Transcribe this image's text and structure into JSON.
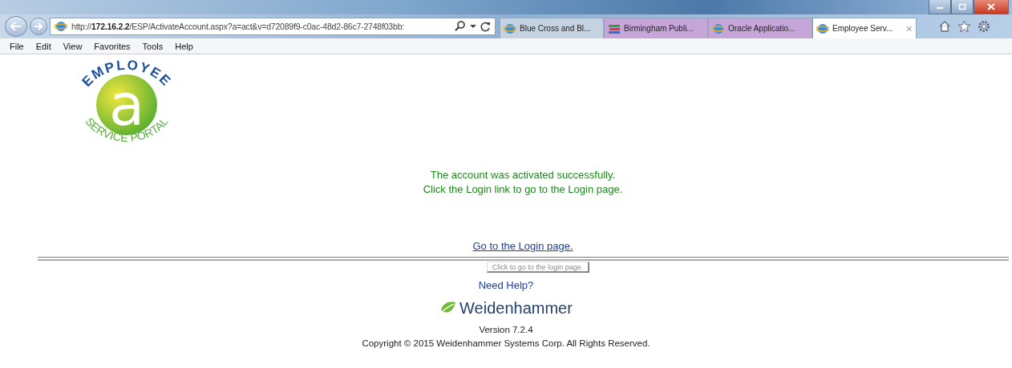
{
  "browser": {
    "address": {
      "prefix": "http://",
      "host": "172.16.2.2",
      "path": "/ESP/ActivateAccount.aspx?a=act&v=d72089f9-c0ac-48d2-86c7-2748f03bb:"
    },
    "tabs": [
      {
        "label": "Blue Cross and Bl...",
        "selected": false,
        "kind": "ie"
      },
      {
        "label": "Birmingham Publi...",
        "selected": false,
        "kind": "books"
      },
      {
        "label": "Oracle Applicatio...",
        "selected": false,
        "kind": "ie"
      },
      {
        "label": "Employee Serv...",
        "selected": true,
        "kind": "ie",
        "close": "×"
      }
    ],
    "menu": [
      "File",
      "Edit",
      "View",
      "Favorites",
      "Tools",
      "Help"
    ]
  },
  "logo": {
    "top": "EMPLOYEE",
    "letter": "a",
    "bottom": "SERVICE PORTAL"
  },
  "messages": [
    "The account was activated successfully.",
    "Click the Login link to go to the Login page."
  ],
  "login_link": "Go to the Login page.",
  "tooltip": "Click to go to the login page.",
  "help_link": "Need Help?",
  "brand": "Weidenhammer",
  "version": "Version 7.2.4",
  "copyright": "Copyright © 2015 Weidenhammer Systems Corp. All Rights Reserved."
}
